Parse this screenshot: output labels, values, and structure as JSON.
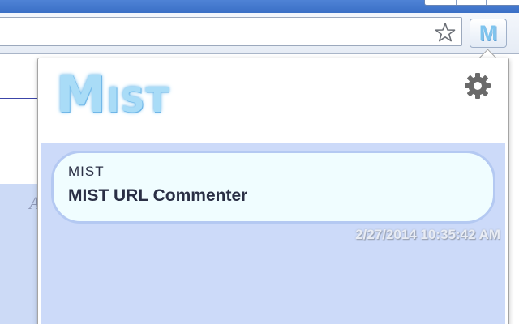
{
  "browser": {
    "toolbar": {
      "bookmark_icon": "star-icon",
      "extension_button": {
        "label": "M",
        "color": "#7ec4ee"
      }
    },
    "page": {
      "visible_glyph": "A"
    }
  },
  "popup": {
    "logo": {
      "first": "M",
      "rest": "IST",
      "color": "#a9dcf7"
    },
    "settings_icon": "gear-icon",
    "body_color": "#ccdaf9",
    "comments": [
      {
        "author": "MIST",
        "text": "MIST URL Commenter",
        "timestamp": "2/27/2014 10:35:42 AM"
      }
    ]
  }
}
